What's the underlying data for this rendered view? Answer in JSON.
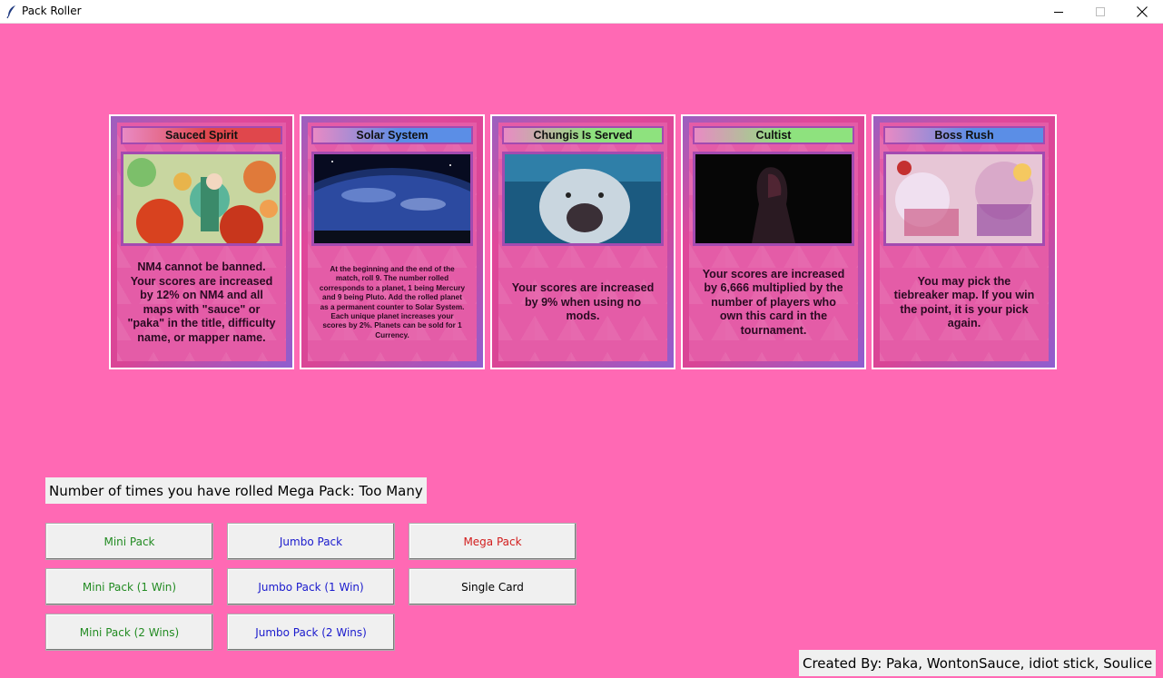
{
  "window": {
    "title": "Pack Roller",
    "app_icon": "feather-icon",
    "controls": [
      "minimize-icon",
      "maximize-icon",
      "close-icon"
    ]
  },
  "cards": [
    {
      "title": "Sauced Spirit",
      "title_color": "#e0474c",
      "art": "anime girl with food",
      "text": "NM4 cannot be banned. Your scores are increased by 12% on NM4 and all maps with \"sauce\" or \"paka\" in the title, difficulty name, or mapper name.",
      "text_size": "big"
    },
    {
      "title": "Solar System",
      "title_color": "#5b8ee6",
      "art": "planet earth from space",
      "text": "At the beginning and the end of the match, roll 9. The number rolled corresponds to a planet, 1 being Mercury and 9 being Pluto. Add the rolled planet as a permanent counter to Solar System. Each unique planet increases your scores by 2%. Planets can be sold for 1 Currency.",
      "text_size": "small"
    },
    {
      "title": "Chungis Is Served",
      "title_color": "#8ee27e",
      "art": "beluga whale",
      "text": "Your scores are increased by 9% when using no mods.",
      "text_size": "big"
    },
    {
      "title": "Cultist",
      "title_color": "#8ee27e",
      "art": "hooded figure",
      "text": "Your scores are increased by 6,666 multiplied by the number of players who own this card in the tournament.",
      "text_size": "big"
    },
    {
      "title": "Boss Rush",
      "title_color": "#5b8ee6",
      "art": "anime characters battle",
      "text": "You may pick the tiebreaker map. If you win the point, it is your pick again.",
      "text_size": "big"
    }
  ],
  "roll_counter": "Number of times you have rolled Mega Pack: Too Many",
  "buttons": {
    "mini_pack": {
      "label": "Mini Pack",
      "color": "#228b22"
    },
    "jumbo_pack": {
      "label": "Jumbo Pack",
      "color": "#1a1acd"
    },
    "mega_pack": {
      "label": "Mega Pack",
      "color": "#d21e1e"
    },
    "mini_pack_1win": {
      "label": "Mini Pack (1 Win)",
      "color": "#228b22"
    },
    "jumbo_pack_1win": {
      "label": "Jumbo Pack (1 Win)",
      "color": "#1a1acd"
    },
    "single_card": {
      "label": "Single Card",
      "color": "#000000"
    },
    "mini_pack_2wins": {
      "label": "Mini Pack (2 Wins)",
      "color": "#228b22"
    },
    "jumbo_pack_2wins": {
      "label": "Jumbo Pack (2 Wins)",
      "color": "#1a1acd"
    }
  },
  "credits": "Created By: Paka, WontonSauce, idiot stick, Soulice",
  "colors": {
    "background": "#ff69b4",
    "card_border": "#a34ab0"
  }
}
